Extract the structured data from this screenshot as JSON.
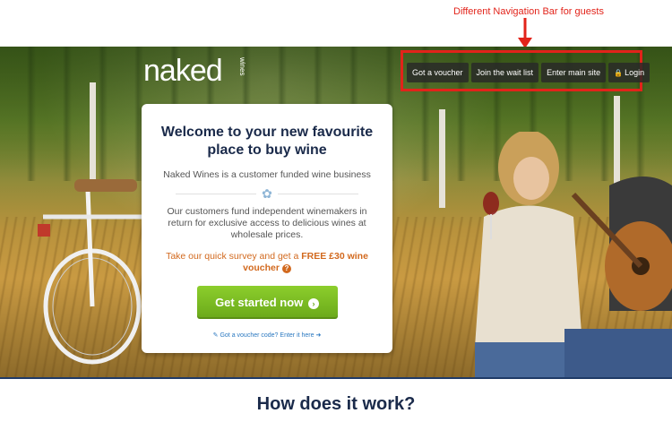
{
  "annotation": {
    "text": "Different Navigation Bar for guests",
    "color": "#e2231a"
  },
  "logo": {
    "main": "naked",
    "sub": "wines"
  },
  "nav": {
    "items": [
      {
        "label": "Got a voucher"
      },
      {
        "label": "Join the wait list"
      },
      {
        "label": "Enter main site"
      },
      {
        "label": "Login",
        "icon": "lock-icon"
      }
    ]
  },
  "card": {
    "title": "Welcome to your new favourite place to buy wine",
    "subtitle": "Naked Wines is a customer funded wine business",
    "description": "Our customers fund independent winemakers in return for exclusive access to delicious wines at wholesale prices.",
    "offer_prefix": "Take our quick survey and get a ",
    "offer_bold": "FREE £30 wine voucher",
    "offer_icon": "question-icon",
    "cta_label": "Get started now",
    "cta_icon": "chevron-right-circle-icon",
    "voucher_link": "Got a voucher code? Enter it here",
    "colors": {
      "title": "#1a2a4a",
      "offer": "#d2691e",
      "cta": "#7ab824",
      "link": "#2a78c0"
    }
  },
  "section": {
    "heading": "How does it work?"
  }
}
